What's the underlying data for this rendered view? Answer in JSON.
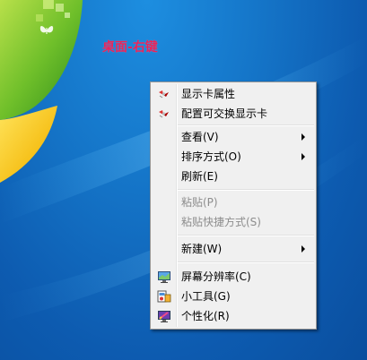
{
  "caption": "桌面-右键",
  "menu": {
    "groups": [
      {
        "items": [
          {
            "label": "显示卡属性",
            "icon": "graphics-card-icon"
          },
          {
            "label": "配置可交换显示卡",
            "icon": "graphics-card-icon"
          }
        ]
      },
      {
        "items": [
          {
            "label": "查看(V)",
            "submenu": true
          },
          {
            "label": "排序方式(O)",
            "submenu": true
          },
          {
            "label": "刷新(E)"
          }
        ]
      },
      {
        "items": [
          {
            "label": "粘贴(P)",
            "disabled": true
          },
          {
            "label": "粘贴快捷方式(S)",
            "disabled": true
          }
        ]
      },
      {
        "items": [
          {
            "label": "新建(W)",
            "submenu": true
          }
        ]
      },
      {
        "items": [
          {
            "label": "屏幕分辨率(C)",
            "icon": "screen-resolution-icon"
          },
          {
            "label": "小工具(G)",
            "icon": "gadgets-icon"
          },
          {
            "label": "个性化(R)",
            "icon": "personalize-icon"
          }
        ]
      }
    ]
  },
  "colors": {
    "caption": "#e8245a",
    "menu_bg": "#f0f0f0",
    "desktop": "#1576c9"
  }
}
